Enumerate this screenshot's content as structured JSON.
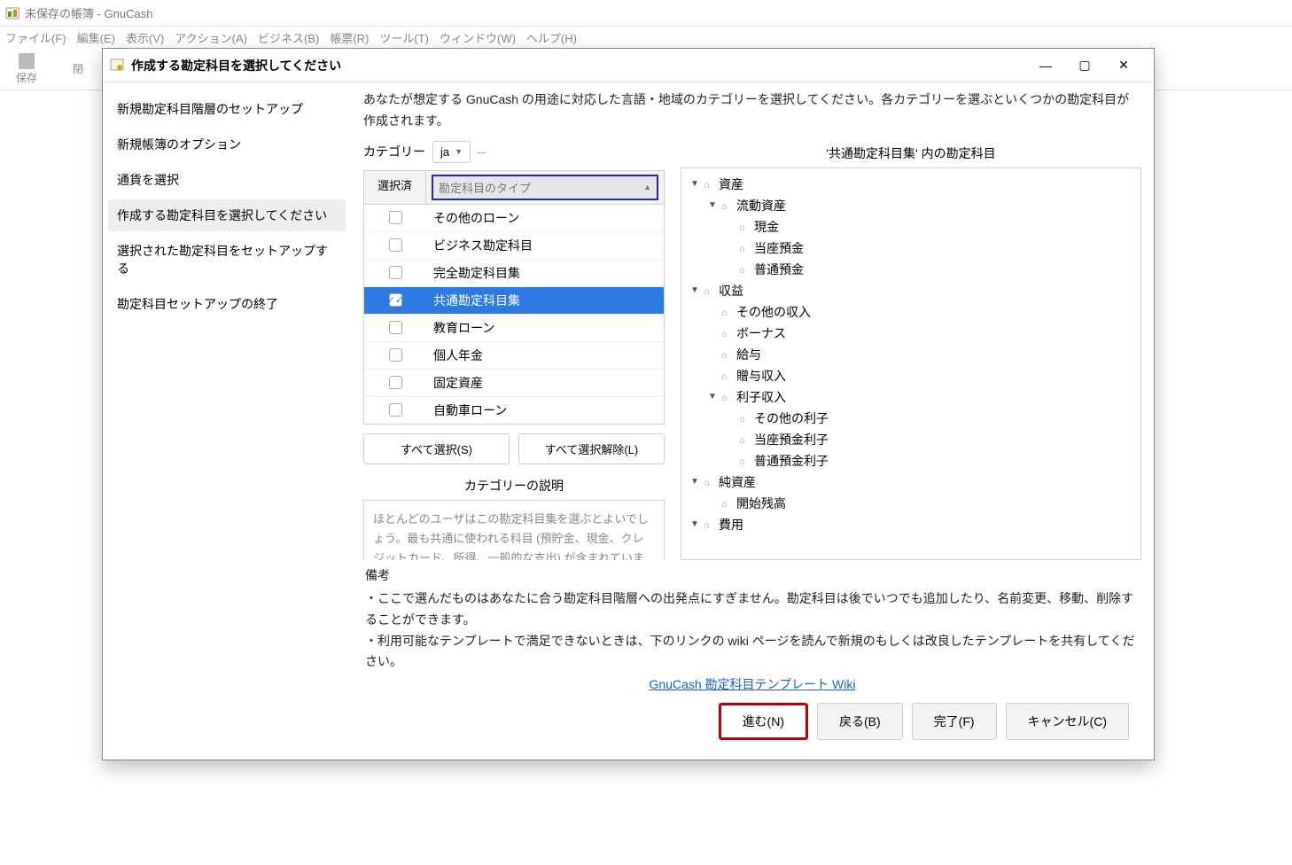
{
  "main_window": {
    "title": "未保存の帳簿 - GnuCash",
    "menu": [
      "ファイル(F)",
      "編集(E)",
      "表示(V)",
      "アクション(A)",
      "ビジネス(B)",
      "帳票(R)",
      "ツール(T)",
      "ウィンドウ(W)",
      "ヘルプ(H)"
    ],
    "toolbar": {
      "save": "保存",
      "close": "閉"
    }
  },
  "dialog": {
    "title": "作成する勘定科目を選択してください",
    "nav": [
      "新規勘定科目階層のセットアップ",
      "新規帳簿のオプション",
      "通貨を選択",
      "作成する勘定科目を選択してください",
      "選択された勘定科目をセットアップする",
      "勘定科目セットアップの終了"
    ],
    "nav_active_index": 3,
    "intro": "あなたが想定する GnuCash の用途に対応した言語・地域のカテゴリーを選択してください。各カテゴリーを選ぶといくつかの勘定科目が作成されます。",
    "category": {
      "label": "カテゴリー",
      "dropdown_value": "ja",
      "dashes": "--",
      "header_col1": "選択済",
      "header_col2": "勘定科目のタイプ",
      "rows": [
        {
          "label": "その他のローン",
          "checked": false,
          "selected": false
        },
        {
          "label": "ビジネス勘定科目",
          "checked": false,
          "selected": false
        },
        {
          "label": "完全勘定科目集",
          "checked": false,
          "selected": false
        },
        {
          "label": "共通勘定科目集",
          "checked": true,
          "selected": true
        },
        {
          "label": "教育ローン",
          "checked": false,
          "selected": false
        },
        {
          "label": "個人年金",
          "checked": false,
          "selected": false
        },
        {
          "label": "固定資産",
          "checked": false,
          "selected": false
        },
        {
          "label": "自動車ローン",
          "checked": false,
          "selected": false
        }
      ],
      "select_all": "すべて選択(S)",
      "clear_all": "すべて選択解除(L)",
      "desc_label": "カテゴリーの説明",
      "desc_text": "ほとんどのユーザはこの勘定科目集を選ぶとよいでしょう。最も共通に使われる科目 (預貯金、現金、クレジットカード、所得、一般的な支出) が含まれています。"
    },
    "accounts": {
      "header": "'共通勘定科目集' 内の勘定科目",
      "tree": [
        {
          "label": "資産",
          "indent": 0,
          "expanded": true
        },
        {
          "label": "流動資産",
          "indent": 1,
          "expanded": true
        },
        {
          "label": "現金",
          "indent": 2
        },
        {
          "label": "当座預金",
          "indent": 2
        },
        {
          "label": "普通預金",
          "indent": 2
        },
        {
          "label": "収益",
          "indent": 0,
          "expanded": true
        },
        {
          "label": "その他の収入",
          "indent": 1
        },
        {
          "label": "ボーナス",
          "indent": 1
        },
        {
          "label": "給与",
          "indent": 1
        },
        {
          "label": "贈与収入",
          "indent": 1
        },
        {
          "label": "利子収入",
          "indent": 1,
          "expanded": true
        },
        {
          "label": "その他の利子",
          "indent": 2
        },
        {
          "label": "当座預金利子",
          "indent": 2
        },
        {
          "label": "普通預金利子",
          "indent": 2
        },
        {
          "label": "純資産",
          "indent": 0,
          "expanded": true
        },
        {
          "label": "開始残高",
          "indent": 1
        },
        {
          "label": "費用",
          "indent": 0,
          "expanded": true
        }
      ]
    },
    "remarks": {
      "label": "備考",
      "b1": "・ここで選んだものはあなたに合う勘定科目階層への出発点にすぎません。勘定科目は後でいつでも追加したり、名前変更、移動、削除することができます。",
      "b2": "・利用可能なテンプレートで満足できないときは、下のリンクの wiki ページを読んで新規のもしくは改良したテンプレートを共有してください。",
      "link": "GnuCash 勘定科目テンプレート Wiki"
    },
    "buttons": {
      "next": "進む(N)",
      "back": "戻る(B)",
      "finish": "完了(F)",
      "cancel": "キャンセル(C)"
    }
  }
}
